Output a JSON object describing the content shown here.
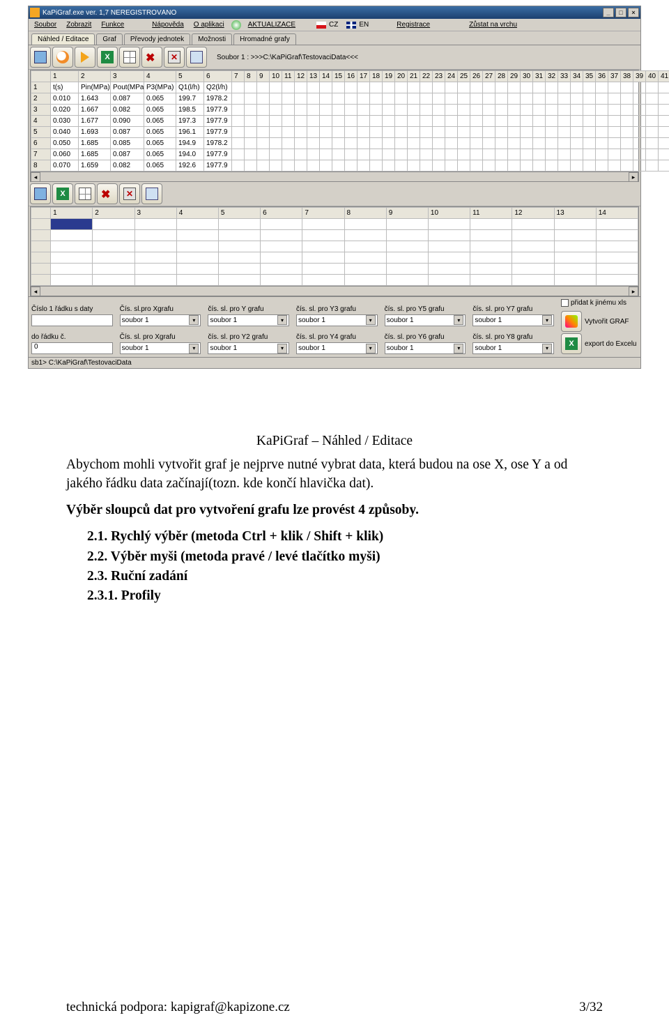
{
  "window": {
    "title": "KaPiGraf.exe   ver. 1,7   NEREGISTROVÁNO",
    "minimize": "_",
    "maximize": "□",
    "close": "×"
  },
  "menubar": {
    "items": [
      "Soubor",
      "Zobrazit",
      "Funkce",
      "Nápověda",
      "O aplikaci"
    ],
    "update": "AKTUALIZACE",
    "lang_cz": "CZ",
    "lang_en": "EN",
    "register": "Registrace",
    "stayontop": "Zůstat na vrchu"
  },
  "tabs": [
    "Náhled / Editace",
    "Graf",
    "Převody jednotek",
    "Možnosti",
    "Hromadné grafy"
  ],
  "toolbar": {
    "path": "Soubor 1 : >>>C:\\KaPiGraf\\TestovaciData<<<"
  },
  "grid1": {
    "colnums": [
      "",
      "1",
      "2",
      "3",
      "4",
      "5",
      "6",
      "7",
      "8",
      "9",
      "10",
      "11",
      "12",
      "13",
      "14",
      "15",
      "16",
      "17",
      "18",
      "19",
      "20",
      "21",
      "22",
      "23",
      "24",
      "25",
      "26",
      "27",
      "28",
      "29",
      "30",
      "31",
      "32",
      "33",
      "34",
      "35",
      "36",
      "37",
      "38",
      "39",
      "40",
      "41"
    ],
    "header": [
      "t(s)",
      "Pin(MPa)",
      "Pout(MPa)",
      "P3(MPa)",
      "Q1(l/h)",
      "Q2(l/h)"
    ],
    "rows": [
      {
        "n": "1"
      },
      {
        "n": "2",
        "v": [
          "0.010",
          "1.643",
          "0.087",
          "0.065",
          "199.7",
          "1978.2"
        ]
      },
      {
        "n": "3",
        "v": [
          "0.020",
          "1.667",
          "0.082",
          "0.065",
          "198.5",
          "1977.9"
        ]
      },
      {
        "n": "4",
        "v": [
          "0.030",
          "1.677",
          "0.090",
          "0.065",
          "197.3",
          "1977.9"
        ]
      },
      {
        "n": "5",
        "v": [
          "0.040",
          "1.693",
          "0.087",
          "0.065",
          "196.1",
          "1977.9"
        ]
      },
      {
        "n": "6",
        "v": [
          "0.050",
          "1.685",
          "0.085",
          "0.065",
          "194.9",
          "1978.2"
        ]
      },
      {
        "n": "7",
        "v": [
          "0.060",
          "1.685",
          "0.087",
          "0.065",
          "194.0",
          "1977.9"
        ]
      },
      {
        "n": "8",
        "v": [
          "0.070",
          "1.659",
          "0.082",
          "0.065",
          "192.6",
          "1977.9"
        ]
      }
    ]
  },
  "grid2": {
    "colnums": [
      "",
      "1",
      "2",
      "3",
      "4",
      "5",
      "6",
      "7",
      "8",
      "9",
      "10",
      "11",
      "12",
      "13",
      "14"
    ]
  },
  "lower": {
    "row1": [
      "Číslo 1 řádku s daty",
      "Čís. sl.pro Xgrafu",
      "čís. sl. pro Y grafu",
      "čís. sl. pro Y3 grafu",
      "čís. sl. pro Y5 grafu",
      "čís. sl. pro Y7 grafu"
    ],
    "row2": [
      "do řádku č.",
      "Čís. sl. pro Xgrafu",
      "čís. sl. pro Y2 grafu",
      "čís. sl. pro Y4 grafu",
      "čís. sl. pro Y6 grafu",
      "čís. sl. pro Y8 grafu"
    ],
    "combo": "soubor 1",
    "input_first": "",
    "input_last": "0",
    "checkbox": "přidat k jinému xls",
    "btn_graf": "Vytvořit GRAF",
    "btn_excel": "export do Excelu"
  },
  "status": "sb1> C:\\KaPiGraf\\TestovaciData",
  "doc": {
    "title": "KaPiGraf – Náhled / Editace",
    "p1": "Abychom mohli vytvořit graf je nejprve nutné vybrat data, která budou na ose X, ose Y a od jakého řádku data začínají(tozn. kde končí hlavička dat).",
    "p2": "Výběr sloupců dat pro vytvoření grafu lze provést 4 způsoby.",
    "methods": [
      "2.1. Rychlý výběr (metoda Ctrl + klik / Shift + klik)",
      "2.2. Výběr myši (metoda pravé / levé tlačítko myši)",
      "2.3. Ruční zadání",
      "2.3.1. Profily"
    ]
  },
  "footer": {
    "left": "technická podpora: kapigraf@kapizone.cz",
    "right": "3/32"
  }
}
